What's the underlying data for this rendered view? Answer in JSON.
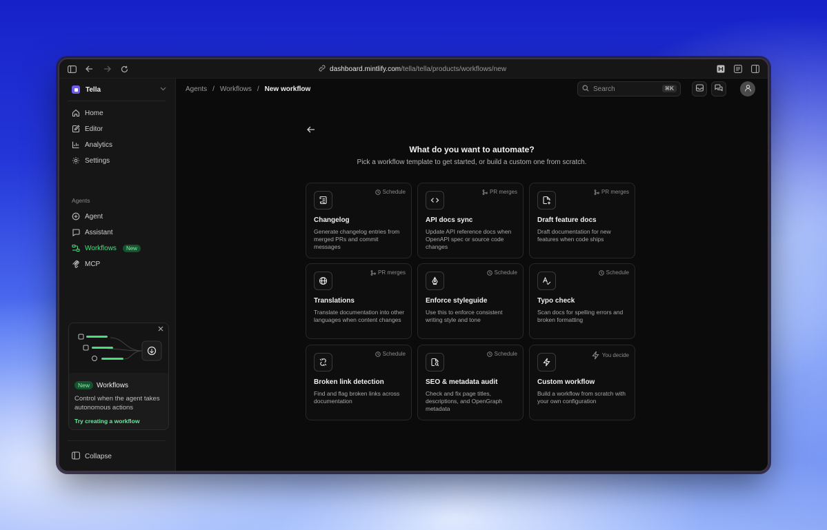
{
  "browser": {
    "url_host": "dashboard.mintlify.com",
    "url_path": "/tella/tella/products/workflows/new"
  },
  "sidebar": {
    "org_name": "Tella",
    "nav": [
      {
        "label": "Home"
      },
      {
        "label": "Editor"
      },
      {
        "label": "Analytics"
      },
      {
        "label": "Settings"
      }
    ],
    "agents_label": "Agents",
    "agents": [
      {
        "label": "Agent"
      },
      {
        "label": "Assistant"
      },
      {
        "label": "Workflows",
        "badge": "New"
      },
      {
        "label": "MCP"
      }
    ],
    "promo": {
      "badge": "New",
      "title": "Workflows",
      "description": "Control when the agent takes autonomous actions",
      "link": "Try creating a workflow"
    },
    "collapse_label": "Collapse"
  },
  "header": {
    "breadcrumb": [
      "Agents",
      "Workflows",
      "New workflow"
    ],
    "search_placeholder": "Search",
    "search_shortcut": "⌘K"
  },
  "page": {
    "heading": "What do you want to automate?",
    "subheading": "Pick a workflow template to get started, or build a custom one from scratch."
  },
  "cards": [
    {
      "title": "Changelog",
      "trigger": "Schedule",
      "trigger_icon": "clock-icon",
      "icon": "scroll-icon",
      "description": "Generate changelog entries from merged PRs and commit messages"
    },
    {
      "title": "API docs sync",
      "trigger": "PR merges",
      "trigger_icon": "git-merge-icon",
      "icon": "code-icon",
      "description": "Update API reference docs when OpenAPI spec or source code changes"
    },
    {
      "title": "Draft feature docs",
      "trigger": "PR merges",
      "trigger_icon": "git-merge-icon",
      "icon": "file-plus-icon",
      "description": "Draft documentation for new features when code ships"
    },
    {
      "title": "Translations",
      "trigger": "PR merges",
      "trigger_icon": "git-merge-icon",
      "icon": "globe-icon",
      "description": "Translate documentation into other languages when content changes"
    },
    {
      "title": "Enforce styleguide",
      "trigger": "Schedule",
      "trigger_icon": "clock-icon",
      "icon": "pen-nib-icon",
      "description": "Use this to enforce consistent writing style and tone"
    },
    {
      "title": "Typo check",
      "trigger": "Schedule",
      "trigger_icon": "clock-icon",
      "icon": "spell-check-icon",
      "description": "Scan docs for spelling errors and broken formatting"
    },
    {
      "title": "Broken link detection",
      "trigger": "Schedule",
      "trigger_icon": "clock-icon",
      "icon": "broken-link-icon",
      "description": "Find and flag broken links across documentation"
    },
    {
      "title": "SEO & metadata audit",
      "trigger": "Schedule",
      "trigger_icon": "clock-icon",
      "icon": "file-search-icon",
      "description": "Check and fix page titles, descriptions, and OpenGraph metadata"
    },
    {
      "title": "Custom workflow",
      "trigger": "You decide",
      "trigger_icon": "bolt-icon",
      "icon": "bolt-icon",
      "description": "Build a workflow from scratch with your own configuration"
    }
  ]
}
